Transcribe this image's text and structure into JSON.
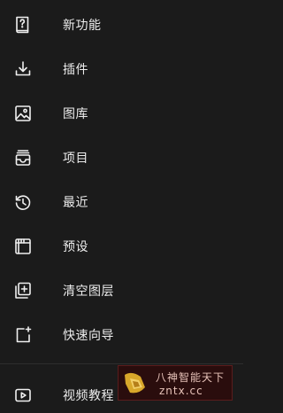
{
  "menu": {
    "items": [
      {
        "label": "新功能",
        "icon": "new-feature-icon"
      },
      {
        "label": "插件",
        "icon": "download-icon"
      },
      {
        "label": "图库",
        "icon": "gallery-icon"
      },
      {
        "label": "项目",
        "icon": "project-icon"
      },
      {
        "label": "最近",
        "icon": "recent-icon"
      },
      {
        "label": "预设",
        "icon": "preset-icon"
      },
      {
        "label": "清空图层",
        "icon": "clear-layers-icon"
      },
      {
        "label": "快速向导",
        "icon": "quick-guide-icon"
      },
      {
        "label": "视频教程",
        "icon": "video-tutorial-icon"
      }
    ]
  },
  "watermark": {
    "line1": "八神智能天下",
    "line2": "zntx.cc"
  },
  "colors": {
    "background": "#1b1b1b",
    "text": "#ececec",
    "icon": "#f0f0f0"
  }
}
